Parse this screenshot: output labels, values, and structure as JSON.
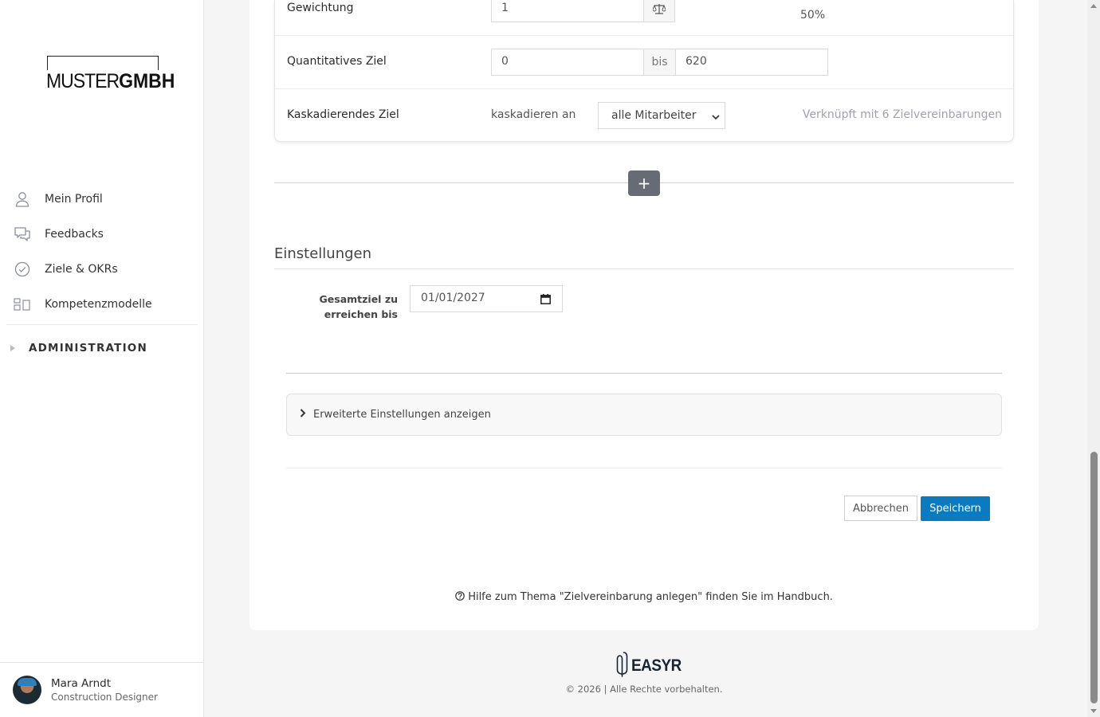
{
  "brand": {
    "logo_light": "MUSTER",
    "logo_bold": "GMBH"
  },
  "sidebar": {
    "items": [
      {
        "label": "Mein Profil",
        "icon": "person-icon"
      },
      {
        "label": "Feedbacks",
        "icon": "chat-bubbles-icon"
      },
      {
        "label": "Ziele & OKRs",
        "icon": "check-circle-icon"
      },
      {
        "label": "Kompetenzmodelle",
        "icon": "blocks-icon"
      }
    ],
    "admin_label": "ADMINISTRATION"
  },
  "user": {
    "name": "Mara Arndt",
    "role": "Construction Designer"
  },
  "goal_form": {
    "weight": {
      "label": "Gewichtung",
      "value": "1",
      "percent": "50%",
      "icon": "scale-icon"
    },
    "quantitative": {
      "label": "Quantitatives Ziel",
      "from": "0",
      "separator": "bis",
      "to": "620"
    },
    "cascade": {
      "label": "Kaskadierendes Ziel",
      "cascade_to_label": "kaskadieren an",
      "selected": "alle Mitarbeiter",
      "linked_text": "Verknüpft mit 6 Zielvereinbarungen"
    },
    "add_button": "+"
  },
  "settings": {
    "title": "Einstellungen",
    "date_label": "Gesamtziel zu erreichen bis",
    "date_value": "01/01/2027",
    "advanced_toggle": "Erweiterte Einstellungen anzeigen"
  },
  "actions": {
    "cancel": "Abbrechen",
    "save": "Speichern"
  },
  "help": {
    "text": "Hilfe zum Thema \"Zielvereinbarung anlegen\" finden Sie im Handbuch."
  },
  "footer": {
    "brand": "EASYR",
    "copyright": "© 2026 | Alle Rechte vorbehalten."
  },
  "colors": {
    "primary": "#0b7bc1",
    "muted_text": "#a0a3ab",
    "plus_button": "#666b74"
  }
}
